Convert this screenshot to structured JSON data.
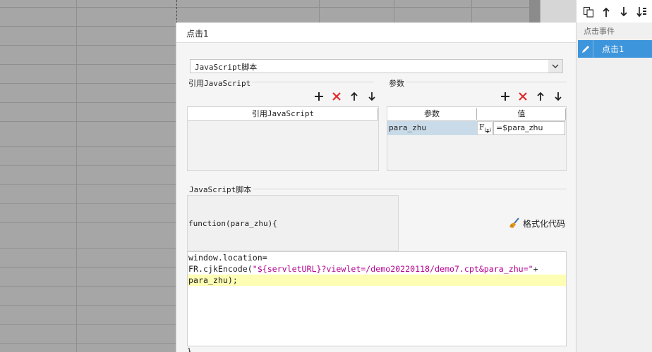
{
  "dialog": {
    "title": "点击1",
    "script_type": "JavaScript脚本",
    "ref_js": {
      "section_label": "引用JavaScript",
      "column_header": "引用JavaScript"
    },
    "params": {
      "section_label": "参数",
      "col_name": "参数",
      "col_value": "值",
      "rows": [
        {
          "name": "para_zhu",
          "fx": "F",
          "fx_sub": "(x)",
          "value": "=$para_zhu"
        }
      ]
    },
    "script": {
      "section_label": "JavaScript脚本",
      "function_header": "function(para_zhu){",
      "format_label": "格式化代码",
      "code": {
        "line1": "window.location=",
        "line2_prefix": "FR.cjkEncode(",
        "line2_string": "\"${servletURL}?viewlet=/demo20220118/demo7.cpt&para_zhu=\"",
        "line2_suffix": "+",
        "line3": "para_zhu);"
      },
      "closing_brace": "}"
    }
  },
  "right_panel": {
    "header": "点击事件",
    "events": [
      {
        "label": "点击1"
      }
    ]
  },
  "colors": {
    "accent": "#3d95db",
    "selected_cell": "#c9dbe9",
    "remove_red": "#e02b2b",
    "string_magenta": "#b3008f",
    "line_highlight": "#fdfdb4"
  },
  "icons": [
    "add-icon",
    "remove-icon",
    "move-up-icon",
    "move-down-icon",
    "dropdown-arrow-icon",
    "fx-icon",
    "broom-icon",
    "copy-icon",
    "sort-icon",
    "pencil-icon"
  ]
}
